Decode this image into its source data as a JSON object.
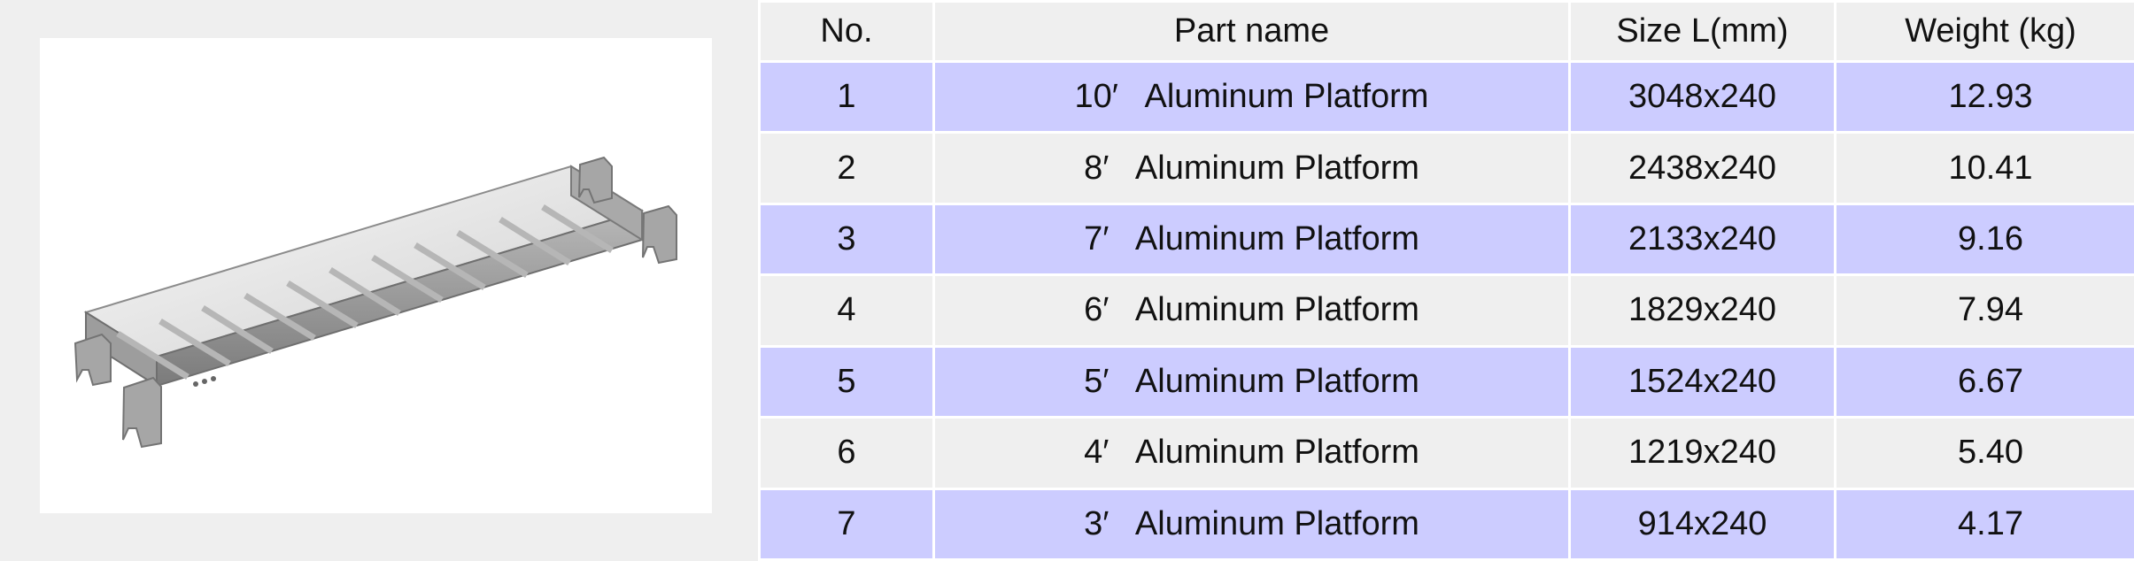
{
  "table": {
    "headers": [
      "No.",
      "Part name",
      "Size  L(mm)",
      "Weight (kg)"
    ],
    "rows": [
      [
        "1",
        "10′   Aluminum Platform",
        "3048x240",
        "12.93"
      ],
      [
        "2",
        "8′   Aluminum Platform",
        "2438x240",
        "10.41"
      ],
      [
        "3",
        "7′   Aluminum Platform",
        "2133x240",
        "9.16"
      ],
      [
        "4",
        "6′   Aluminum Platform",
        "1829x240",
        "7.94"
      ],
      [
        "5",
        "5′   Aluminum Platform",
        "1524x240",
        "6.67"
      ],
      [
        "6",
        "4′   Aluminum Platform",
        "1219x240",
        "5.40"
      ],
      [
        "7",
        "3′   Aluminum Platform",
        "914x240",
        "4.17"
      ]
    ]
  },
  "colors": {
    "odd_row": "#ccccff",
    "even_row": "#efefef",
    "background": "#efefef"
  }
}
